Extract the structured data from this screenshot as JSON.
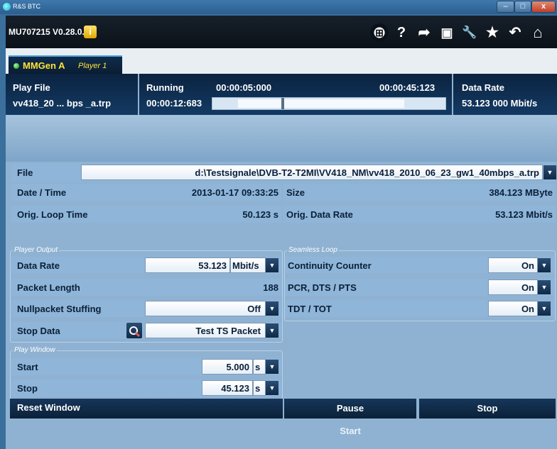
{
  "window": {
    "title": "R&S BTC",
    "min": "–",
    "max": "□",
    "close": "x"
  },
  "toolbar": {
    "version": "MU707215 V0.28.0.0",
    "info": "i",
    "icons": {
      "windows": "⊞",
      "help": "?",
      "forward": "➦",
      "save": "▣",
      "wrench": "🔧",
      "star": "★",
      "back": "↶",
      "home": "⌂"
    }
  },
  "tab": {
    "name": "MMGen A",
    "player": "Player 1"
  },
  "header": {
    "play_file_label": "Play File",
    "play_file_value": "vv418_20 ... bps _a.trp",
    "running_label": "Running",
    "running_elapsed": "00:00:12:683",
    "running_start": "00:00:05:000",
    "running_end": "00:00:45:123",
    "progress_fraction": 0.3,
    "data_rate_label": "Data Rate",
    "data_rate_value": "53.123 000 Mbit/s"
  },
  "file": {
    "label": "File",
    "value": "d:\\Testsignale\\DVB-T2-T2MI\\VV418_NM\\vv418_2010_06_23_gw1_40mbps_a.trp"
  },
  "info": {
    "date_time_label": "Date / Time",
    "date_time_value": "2013-01-17 09:33:25",
    "size_label": "Size",
    "size_value": "384.123 MByte",
    "orig_loop_label": "Orig. Loop Time",
    "orig_loop_value": "50.123 s",
    "orig_rate_label": "Orig. Data Rate",
    "orig_rate_value": "53.123 Mbit/s"
  },
  "player_output": {
    "group_label": "Player Output",
    "data_rate_label": "Data Rate",
    "data_rate_value": "53.123",
    "data_rate_unit": "Mbit/s",
    "packet_length_label": "Packet Length",
    "packet_length_value": "188",
    "nullpacket_label": "Nullpacket Stuffing",
    "nullpacket_value": "Off",
    "stop_data_label": "Stop Data",
    "stop_data_value": "Test TS Packet"
  },
  "seamless_loop": {
    "group_label": "Seamless Loop",
    "cc_label": "Continuity Counter",
    "cc_value": "On",
    "pcr_label": "PCR, DTS / PTS",
    "pcr_value": "On",
    "tdt_label": "TDT / TOT",
    "tdt_value": "On"
  },
  "play_window": {
    "group_label": "Play Window",
    "start_label": "Start",
    "start_value": "5.000",
    "start_unit": "s",
    "stop_label": "Stop",
    "stop_value": "45.123",
    "stop_unit": "s"
  },
  "buttons": {
    "reset_window": "Reset Window",
    "pause": "Pause",
    "stop": "Stop",
    "start": "Start"
  },
  "dropdown_glyph": "▼"
}
